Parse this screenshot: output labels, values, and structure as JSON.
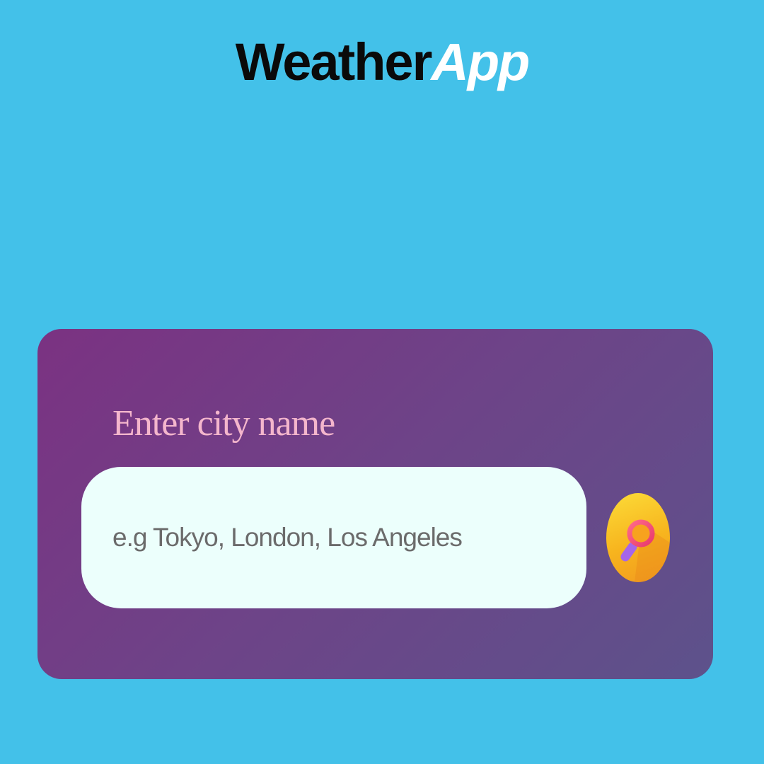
{
  "header": {
    "title_main": "Weather",
    "title_accent": "App"
  },
  "search": {
    "label": "Enter city name",
    "placeholder": "e.g Tokyo, London, Los Angeles",
    "value": "",
    "button_icon": "search-icon"
  },
  "colors": {
    "background": "#43c1e9",
    "card_gradient_start": "#7b3282",
    "card_gradient_end": "#5d528b",
    "label": "#f4b6cc",
    "input_background": "#ecfffc",
    "button_yellow": "#fcdc38",
    "button_orange": "#f19a1f",
    "icon_pink": "#f0457a",
    "icon_purple": "#a566ea"
  }
}
